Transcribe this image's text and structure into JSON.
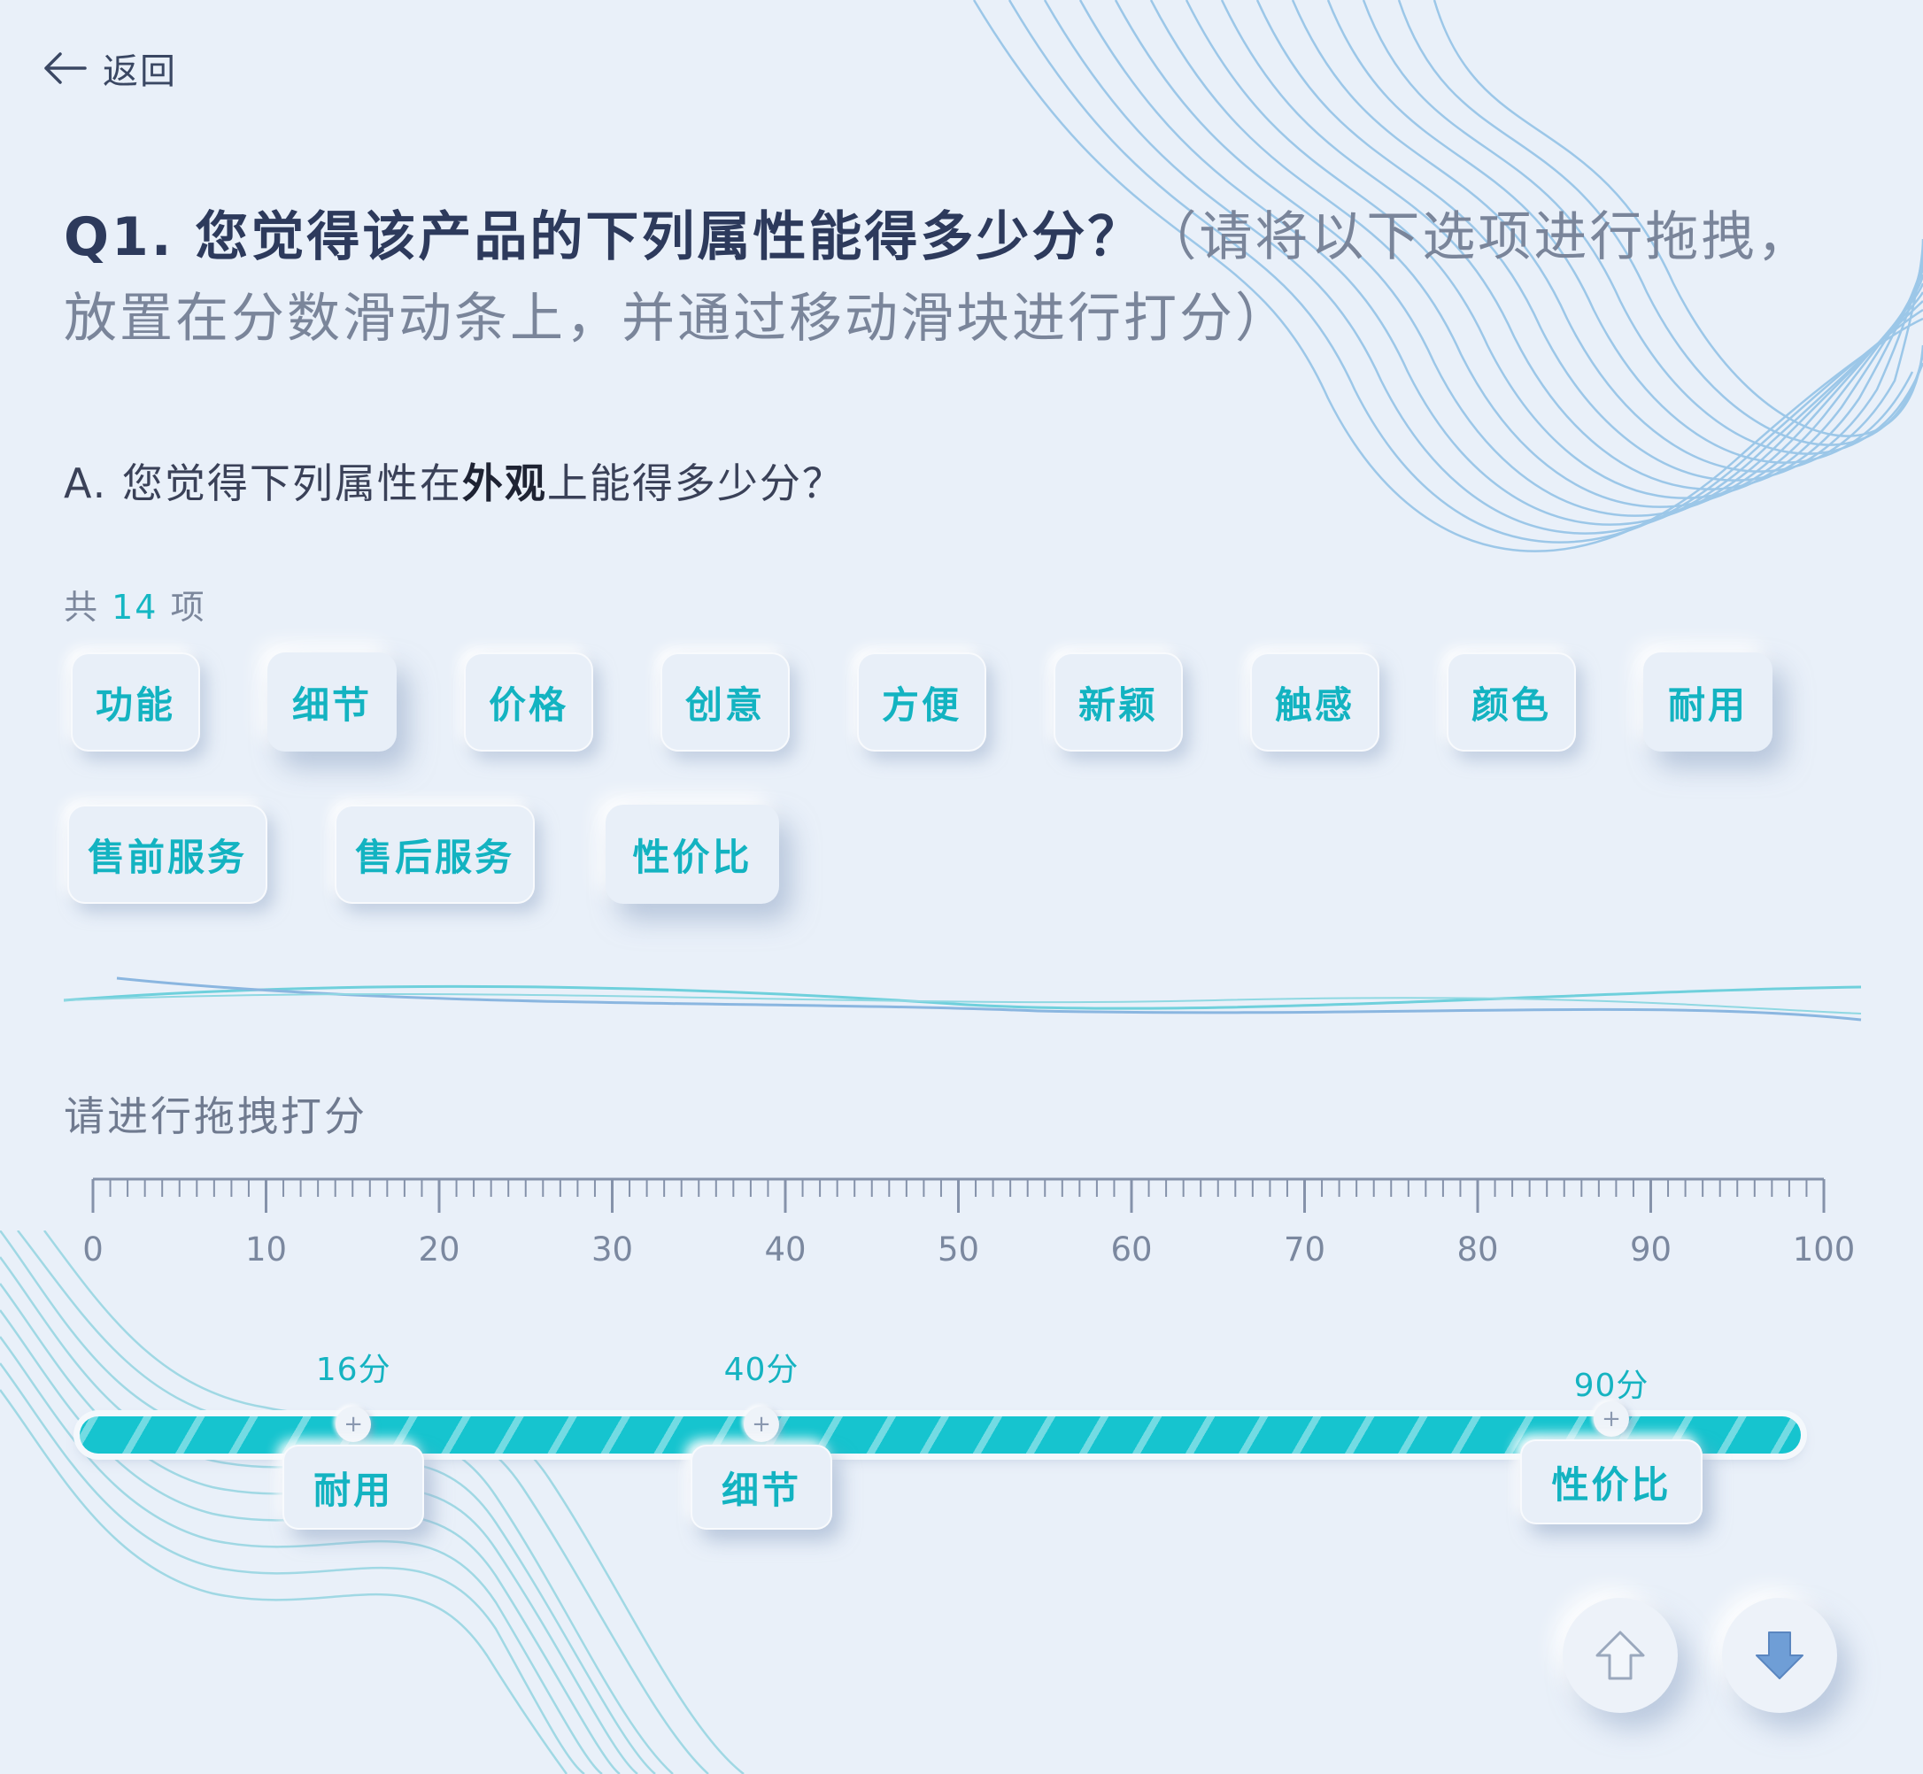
{
  "nav": {
    "back_label": "返回"
  },
  "question": {
    "title": "Q1. 您觉得该产品的下列属性能得多少分？",
    "hint": "（请将以下选项进行拖拽，放置在分数滑动条上，并通过移动滑块进行打分）"
  },
  "sub_question": {
    "prefix": "A. 您觉得下列属性在",
    "highlight": "外观",
    "suffix": "上能得多少分？"
  },
  "options": {
    "count_prefix": "共",
    "count": "14",
    "count_suffix": "项",
    "items": [
      "功能",
      "细节",
      "价格",
      "创意",
      "方便",
      "新颖",
      "触感",
      "颜色",
      "耐用",
      "售前服务",
      "售后服务",
      "性价比"
    ]
  },
  "slider": {
    "label": "请进行拖拽打分",
    "min": 0,
    "max": 100,
    "tick_labels": [
      "0",
      "10",
      "20",
      "30",
      "40",
      "50",
      "60",
      "70",
      "80",
      "90",
      "100"
    ],
    "placed": [
      {
        "name": "耐用",
        "value": 16,
        "score_label": "16分"
      },
      {
        "name": "细节",
        "value": 40,
        "score_label": "40分"
      },
      {
        "name": "性价比",
        "value": 90,
        "score_label": "90分"
      }
    ]
  },
  "controls": {
    "up_icon": "arrow-up-icon",
    "down_icon": "arrow-down-icon"
  },
  "colors": {
    "accent": "#15b7c3",
    "background": "#e9f0f9",
    "text": "#34405c"
  }
}
